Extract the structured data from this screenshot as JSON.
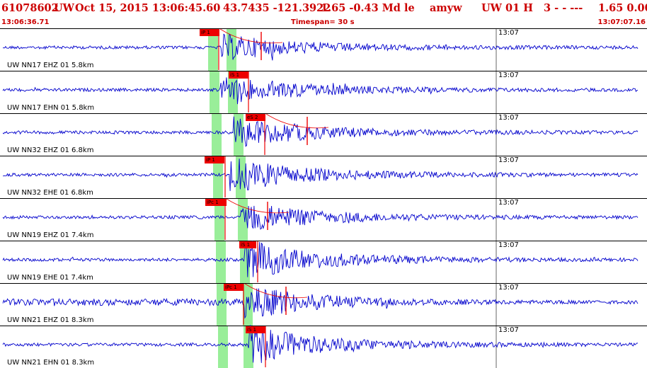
{
  "header": {
    "event_id": "61078602",
    "network": "UW",
    "datetime": "Oct 15, 2015 13:06:45.60",
    "location": "43.7435 -121.3922",
    "magnitude": "1.65 -0.43 Md le",
    "station_code": "amyw",
    "source": "UW 01 H",
    "quality": "3 - - ---",
    "extra": "1.65 0.00"
  },
  "subheader": {
    "start_time": "13:06:36.71",
    "timespan": "Timespan= 30 s",
    "end_time": "13:07:07.16"
  },
  "minute_mark": "13:07",
  "traces": [
    {
      "label": "UW NN17 EHZ 01 5.8km",
      "pick": "iP 1"
    },
    {
      "label": "UW NN17 EHN 01 5.8km",
      "pick": "iS 1"
    },
    {
      "label": "UW NN32 EHZ 01 6.8km",
      "pick": "eS 2"
    },
    {
      "label": "UW NN32 EHE 01 6.8km",
      "pick": "iP 1"
    },
    {
      "label": "UW NN19 EHZ 01 7.4km",
      "pick": "iPc 1"
    },
    {
      "label": "UW NN19 EHE 01 7.4km",
      "pick": "iS 1"
    },
    {
      "label": "UW NN21 EHZ 01 8.3km",
      "pick": "iPc 1"
    },
    {
      "label": "UW NN21 EHN 01 8.3km",
      "pick": "iS 1"
    }
  ],
  "colors": {
    "title": "#cc0000",
    "trace": "#0000cc",
    "pick": "#ee0000",
    "window": "#99ee99"
  }
}
